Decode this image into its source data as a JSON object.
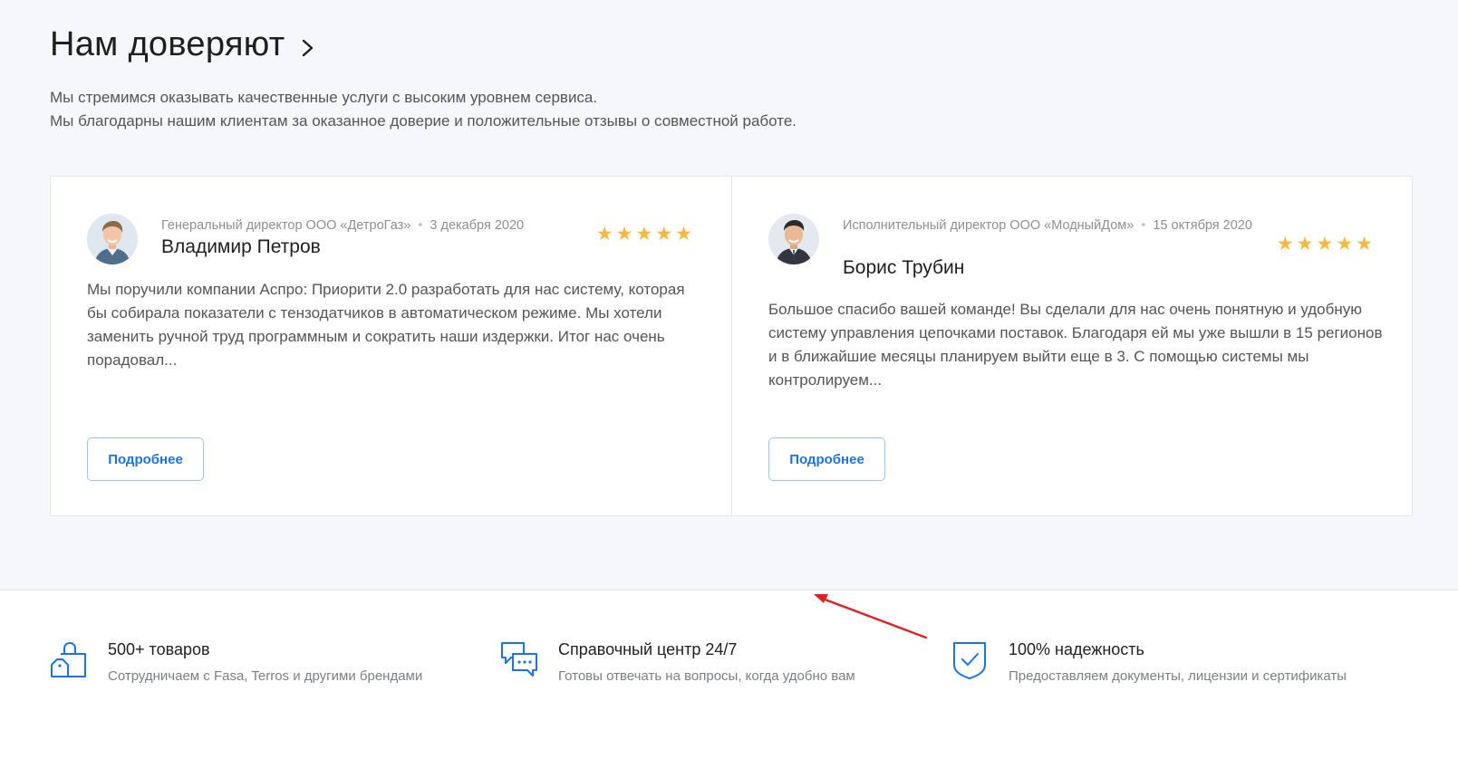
{
  "section": {
    "title": "Нам доверяют",
    "intro_line1": "Мы стремимся оказывать качественные услуги с высоким уровнем сервиса.",
    "intro_line2": "Мы благодарны нашим клиентам за оказанное доверие и положительные отзывы о совместной работе."
  },
  "reviews": [
    {
      "position": "Генеральный директор ООО «ДетроГаз»",
      "date": "3 декабря 2020",
      "name": "Владимир Петров",
      "stars": "★★★★★",
      "rating": 5,
      "text": "Мы поручили компании Аспро: Приорити 2.0 разработать для нас систему, которая бы собирала показатели с тензодатчиков в автоматическом режиме. Мы хотели заменить ручной труд программным и сократить наши издержки. Итог нас очень порадовал...",
      "button": "Подробнее"
    },
    {
      "position": "Исполнительный директор ООО «МодныйДом»",
      "date": "15 октября 2020",
      "name": "Борис Трубин",
      "stars": "★★★★★",
      "rating": 5,
      "text": "Большое спасибо вашей команде! Вы сделали для нас очень понятную и удобную систему управления цепочками поставок. Благодаря ей мы уже вышли в 15 регионов и в ближайшие месяцы планируем выйти еще в 3. С помощью системы мы контролируем...",
      "button": "Подробнее"
    }
  ],
  "features": [
    {
      "icon": "shopping-bags-icon",
      "title": "500+ товаров",
      "subtitle": "Сотрудничаем с Fasa, Terros и другими брендами"
    },
    {
      "icon": "chat-bubbles-icon",
      "title": "Справочный центр 24/7",
      "subtitle": "Готовы отвечать на вопросы, когда удобно вам"
    },
    {
      "icon": "shield-check-icon",
      "title": "100% надежность",
      "subtitle": "Предоставляем документы, лицензии и сертификаты"
    }
  ],
  "colors": {
    "accent": "#1a73e8",
    "star": "#f5b942",
    "annotation_arrow": "#e02020",
    "section_bg": "#f6f7fa"
  }
}
